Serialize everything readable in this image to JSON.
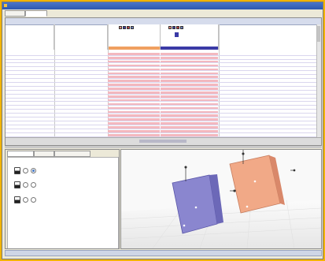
{
  "window": {
    "title": ""
  },
  "tabs": [
    {
      "label": ""
    },
    {
      "label": ""
    }
  ],
  "grid": {
    "header_title": "",
    "rows": [
      {
        "name": "",
        "type": "",
        "value": ""
      },
      {
        "name": "",
        "type": "",
        "value": ""
      },
      {
        "name": "",
        "type": "",
        "value": ""
      },
      {
        "name": "",
        "type": "",
        "value": ""
      },
      {
        "name": "",
        "type": "",
        "value": ""
      },
      {
        "name": "",
        "type": "",
        "value": ""
      },
      {
        "name": "",
        "type": "",
        "value": ""
      },
      {
        "name": "",
        "type": "",
        "value": ""
      },
      {
        "name": "",
        "type": "",
        "value": ""
      },
      {
        "name": "",
        "type": "",
        "value": ""
      },
      {
        "name": "",
        "type": "",
        "value": ""
      },
      {
        "name": "",
        "type": "",
        "value": ""
      },
      {
        "name": "",
        "type": "",
        "value": ""
      },
      {
        "name": "",
        "type": "",
        "value": ""
      },
      {
        "name": "",
        "type": "",
        "value": ""
      },
      {
        "name": "",
        "type": "",
        "value": ""
      },
      {
        "name": "",
        "type": "",
        "value": ""
      },
      {
        "name": "",
        "type": "",
        "value": ""
      },
      {
        "name": "",
        "type": "",
        "value": ""
      },
      {
        "name": "",
        "type": "",
        "value": ""
      },
      {
        "name": "",
        "type": "",
        "value": ""
      },
      {
        "name": "",
        "type": "",
        "value": ""
      }
    ],
    "scrollbar_label": ""
  },
  "left_panel": {
    "tabs": [
      {
        "label": ""
      },
      {
        "label": ""
      },
      {
        "label": ""
      }
    ],
    "options": [
      {
        "label": ""
      },
      {
        "label": ""
      },
      {
        "label": ""
      }
    ]
  },
  "status_bar": {
    "text": ""
  },
  "colors": {
    "highlight_row": "#f3b8bf",
    "plane_blue": "#8a86cf",
    "plane_orange": "#f1a987",
    "frame": "#f2b400"
  }
}
